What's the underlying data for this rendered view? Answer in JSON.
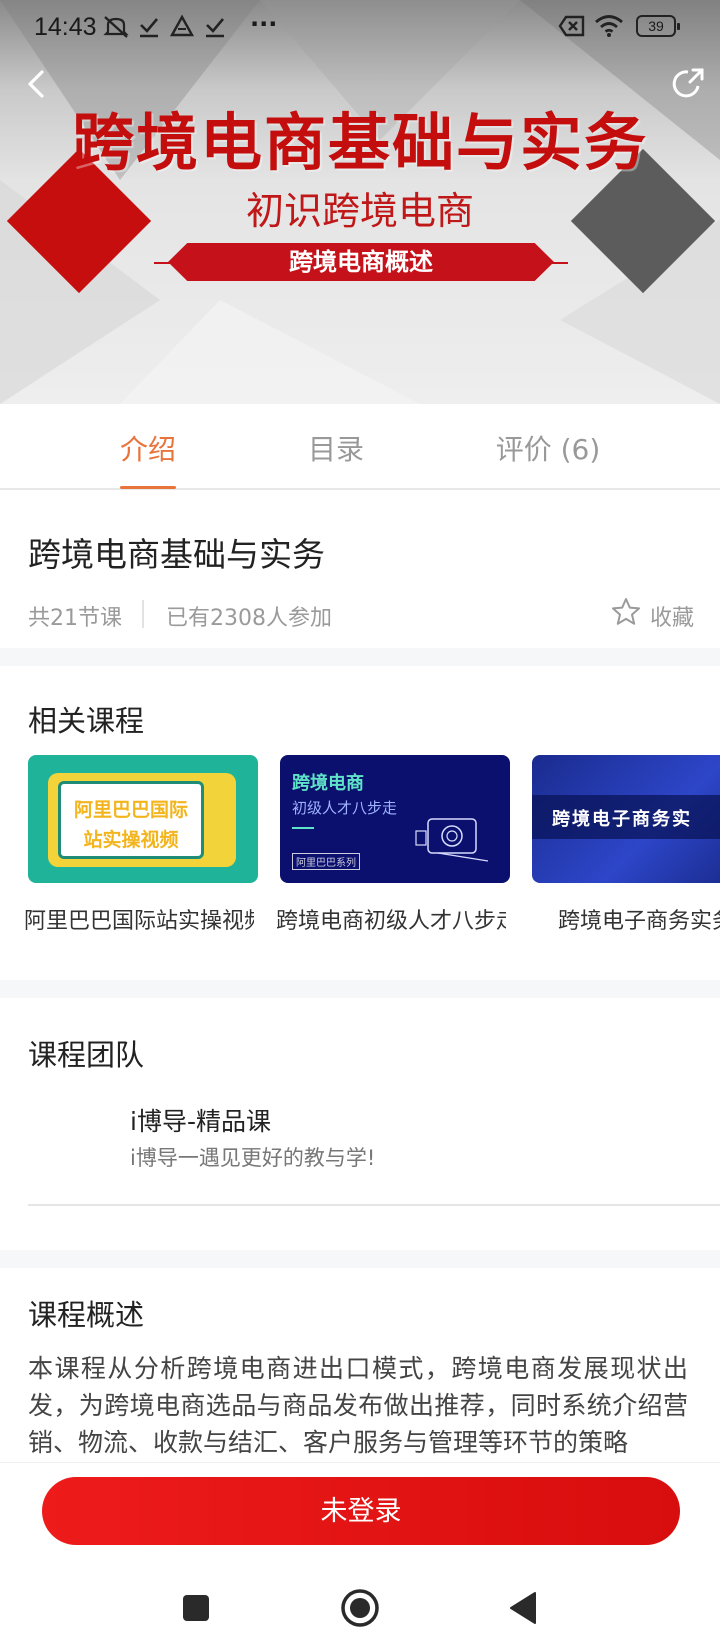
{
  "status_bar": {
    "time": "14:43",
    "more": "···",
    "battery": "39"
  },
  "hero": {
    "title": "跨境电商基础与实务",
    "subtitle": "初识跨境电商",
    "ribbon": "跨境电商概述"
  },
  "tabs": [
    {
      "label": "介绍",
      "active": true
    },
    {
      "label": "目录",
      "active": false
    },
    {
      "label": "评价 (6)",
      "active": false
    }
  ],
  "course": {
    "title": "跨境电商基础与实务",
    "lessons": "共21节课",
    "participants": "已有2308人参加",
    "favorite_label": "收藏"
  },
  "related": {
    "heading": "相关课程",
    "items": [
      {
        "label": "阿里巴巴国际站实操视频",
        "thumb_line1": "阿里巴巴国际",
        "thumb_line2": "站实操视频"
      },
      {
        "label": "跨境电商初级人才八步走",
        "thumb_line1": "跨境电商",
        "thumb_line2": "初级人才八步走",
        "thumb_tag": "阿里巴巴系列"
      },
      {
        "label": "跨境电子商务实务",
        "thumb_line1": "跨境电子商务实"
      }
    ]
  },
  "team": {
    "heading": "课程团队",
    "name": "i博导-精品课",
    "description": "i博导一遇见更好的教与学!"
  },
  "overview": {
    "heading": "课程概述",
    "text": "本课程从分析跨境电商进出口模式，跨境电商发展现状出发，为跨境电商选品与商品发布做出推荐，同时系统介绍营销、物流、收款与结汇、客户服务与管理等环节的策略"
  },
  "bottom": {
    "login_label": "未登录"
  },
  "colors": {
    "accent_orange": "#e8743c",
    "login_red": "#e31414",
    "hero_red": "#c40d0d"
  },
  "icons": [
    "mute-icon",
    "check-icon",
    "drive-icon",
    "close-box-icon",
    "wifi-icon",
    "battery-icon",
    "back-icon",
    "share-icon",
    "star-icon",
    "square-nav-icon",
    "home-nav-icon",
    "back-nav-icon"
  ]
}
